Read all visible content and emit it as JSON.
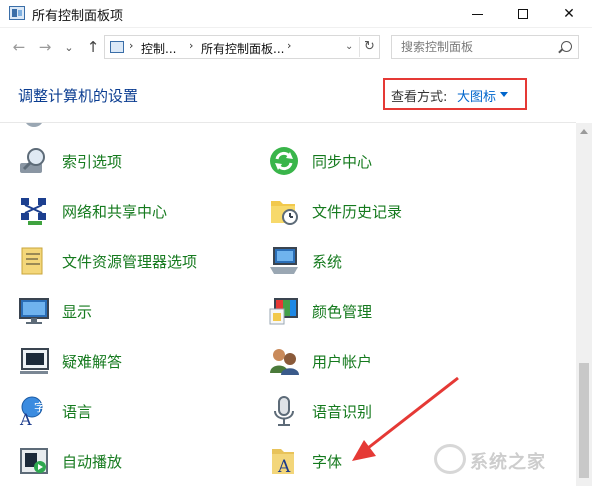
{
  "window": {
    "title": "所有控制面板项",
    "controls": {
      "minimize": "minimize",
      "maximize": "maximize",
      "close": "✕"
    }
  },
  "navigation": {
    "back": "←",
    "forward": "→",
    "recent": "⌄",
    "up": "↑",
    "address": {
      "segments": [
        "控制...",
        "所有控制面板...",
        ""
      ],
      "separators": [
        "›",
        "›",
        "›"
      ],
      "dropdown": "⌄",
      "refresh": "↻"
    },
    "search": {
      "placeholder": "搜索控制面板"
    }
  },
  "header": {
    "title": "调整计算机的设置",
    "view_by": {
      "label": "查看方式:",
      "value": "大图标"
    },
    "highlight_color": "#e53935"
  },
  "items": {
    "left": [
      {
        "label": "索引选项",
        "icon": "index-options-icon"
      },
      {
        "label": "网络和共享中心",
        "icon": "network-sharing-icon"
      },
      {
        "label": "文件资源管理器选项",
        "icon": "file-explorer-options-icon"
      },
      {
        "label": "显示",
        "icon": "display-icon"
      },
      {
        "label": "疑难解答",
        "icon": "troubleshooting-icon"
      },
      {
        "label": "语言",
        "icon": "language-icon"
      },
      {
        "label": "自动播放",
        "icon": "autoplay-icon"
      }
    ],
    "right": [
      {
        "label": "同步中心",
        "icon": "sync-center-icon"
      },
      {
        "label": "文件历史记录",
        "icon": "file-history-icon"
      },
      {
        "label": "系统",
        "icon": "system-icon"
      },
      {
        "label": "颜色管理",
        "icon": "color-management-icon"
      },
      {
        "label": "用户帐户",
        "icon": "user-accounts-icon"
      },
      {
        "label": "语音识别",
        "icon": "speech-recognition-icon"
      },
      {
        "label": "字体",
        "icon": "fonts-icon"
      }
    ]
  },
  "colors": {
    "link_green": "#157a1e",
    "link_blue": "#0066cc",
    "title_blue": "#0b3d91",
    "annotation_red": "#e53935"
  },
  "watermark": {
    "text": "系统之家"
  }
}
